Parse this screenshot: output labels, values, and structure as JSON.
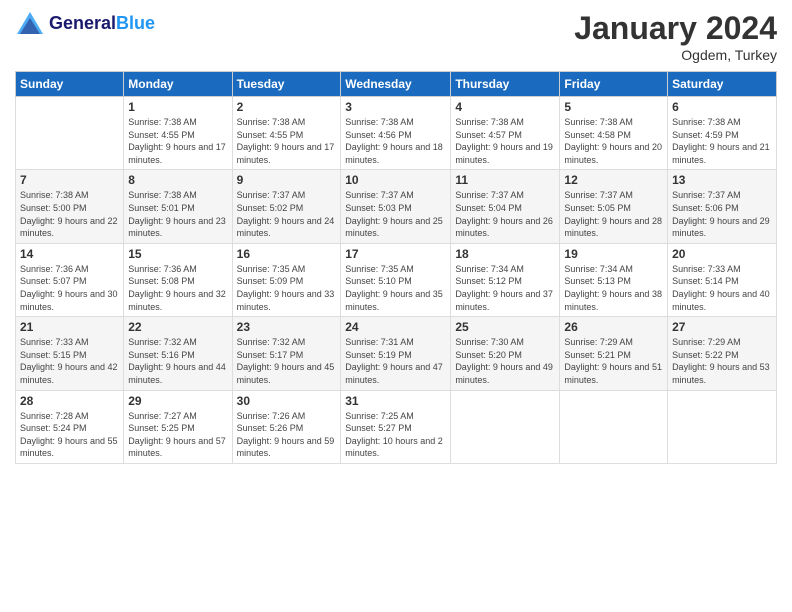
{
  "header": {
    "logo_line1": "General",
    "logo_line2": "Blue",
    "month_year": "January 2024",
    "location": "Ogdem, Turkey"
  },
  "days_of_week": [
    "Sunday",
    "Monday",
    "Tuesday",
    "Wednesday",
    "Thursday",
    "Friday",
    "Saturday"
  ],
  "weeks": [
    [
      {
        "day": "",
        "sunrise": "",
        "sunset": "",
        "daylight": ""
      },
      {
        "day": "1",
        "sunrise": "Sunrise: 7:38 AM",
        "sunset": "Sunset: 4:55 PM",
        "daylight": "Daylight: 9 hours and 17 minutes."
      },
      {
        "day": "2",
        "sunrise": "Sunrise: 7:38 AM",
        "sunset": "Sunset: 4:55 PM",
        "daylight": "Daylight: 9 hours and 17 minutes."
      },
      {
        "day": "3",
        "sunrise": "Sunrise: 7:38 AM",
        "sunset": "Sunset: 4:56 PM",
        "daylight": "Daylight: 9 hours and 18 minutes."
      },
      {
        "day": "4",
        "sunrise": "Sunrise: 7:38 AM",
        "sunset": "Sunset: 4:57 PM",
        "daylight": "Daylight: 9 hours and 19 minutes."
      },
      {
        "day": "5",
        "sunrise": "Sunrise: 7:38 AM",
        "sunset": "Sunset: 4:58 PM",
        "daylight": "Daylight: 9 hours and 20 minutes."
      },
      {
        "day": "6",
        "sunrise": "Sunrise: 7:38 AM",
        "sunset": "Sunset: 4:59 PM",
        "daylight": "Daylight: 9 hours and 21 minutes."
      }
    ],
    [
      {
        "day": "7",
        "sunrise": "Sunrise: 7:38 AM",
        "sunset": "Sunset: 5:00 PM",
        "daylight": "Daylight: 9 hours and 22 minutes."
      },
      {
        "day": "8",
        "sunrise": "Sunrise: 7:38 AM",
        "sunset": "Sunset: 5:01 PM",
        "daylight": "Daylight: 9 hours and 23 minutes."
      },
      {
        "day": "9",
        "sunrise": "Sunrise: 7:37 AM",
        "sunset": "Sunset: 5:02 PM",
        "daylight": "Daylight: 9 hours and 24 minutes."
      },
      {
        "day": "10",
        "sunrise": "Sunrise: 7:37 AM",
        "sunset": "Sunset: 5:03 PM",
        "daylight": "Daylight: 9 hours and 25 minutes."
      },
      {
        "day": "11",
        "sunrise": "Sunrise: 7:37 AM",
        "sunset": "Sunset: 5:04 PM",
        "daylight": "Daylight: 9 hours and 26 minutes."
      },
      {
        "day": "12",
        "sunrise": "Sunrise: 7:37 AM",
        "sunset": "Sunset: 5:05 PM",
        "daylight": "Daylight: 9 hours and 28 minutes."
      },
      {
        "day": "13",
        "sunrise": "Sunrise: 7:37 AM",
        "sunset": "Sunset: 5:06 PM",
        "daylight": "Daylight: 9 hours and 29 minutes."
      }
    ],
    [
      {
        "day": "14",
        "sunrise": "Sunrise: 7:36 AM",
        "sunset": "Sunset: 5:07 PM",
        "daylight": "Daylight: 9 hours and 30 minutes."
      },
      {
        "day": "15",
        "sunrise": "Sunrise: 7:36 AM",
        "sunset": "Sunset: 5:08 PM",
        "daylight": "Daylight: 9 hours and 32 minutes."
      },
      {
        "day": "16",
        "sunrise": "Sunrise: 7:35 AM",
        "sunset": "Sunset: 5:09 PM",
        "daylight": "Daylight: 9 hours and 33 minutes."
      },
      {
        "day": "17",
        "sunrise": "Sunrise: 7:35 AM",
        "sunset": "Sunset: 5:10 PM",
        "daylight": "Daylight: 9 hours and 35 minutes."
      },
      {
        "day": "18",
        "sunrise": "Sunrise: 7:34 AM",
        "sunset": "Sunset: 5:12 PM",
        "daylight": "Daylight: 9 hours and 37 minutes."
      },
      {
        "day": "19",
        "sunrise": "Sunrise: 7:34 AM",
        "sunset": "Sunset: 5:13 PM",
        "daylight": "Daylight: 9 hours and 38 minutes."
      },
      {
        "day": "20",
        "sunrise": "Sunrise: 7:33 AM",
        "sunset": "Sunset: 5:14 PM",
        "daylight": "Daylight: 9 hours and 40 minutes."
      }
    ],
    [
      {
        "day": "21",
        "sunrise": "Sunrise: 7:33 AM",
        "sunset": "Sunset: 5:15 PM",
        "daylight": "Daylight: 9 hours and 42 minutes."
      },
      {
        "day": "22",
        "sunrise": "Sunrise: 7:32 AM",
        "sunset": "Sunset: 5:16 PM",
        "daylight": "Daylight: 9 hours and 44 minutes."
      },
      {
        "day": "23",
        "sunrise": "Sunrise: 7:32 AM",
        "sunset": "Sunset: 5:17 PM",
        "daylight": "Daylight: 9 hours and 45 minutes."
      },
      {
        "day": "24",
        "sunrise": "Sunrise: 7:31 AM",
        "sunset": "Sunset: 5:19 PM",
        "daylight": "Daylight: 9 hours and 47 minutes."
      },
      {
        "day": "25",
        "sunrise": "Sunrise: 7:30 AM",
        "sunset": "Sunset: 5:20 PM",
        "daylight": "Daylight: 9 hours and 49 minutes."
      },
      {
        "day": "26",
        "sunrise": "Sunrise: 7:29 AM",
        "sunset": "Sunset: 5:21 PM",
        "daylight": "Daylight: 9 hours and 51 minutes."
      },
      {
        "day": "27",
        "sunrise": "Sunrise: 7:29 AM",
        "sunset": "Sunset: 5:22 PM",
        "daylight": "Daylight: 9 hours and 53 minutes."
      }
    ],
    [
      {
        "day": "28",
        "sunrise": "Sunrise: 7:28 AM",
        "sunset": "Sunset: 5:24 PM",
        "daylight": "Daylight: 9 hours and 55 minutes."
      },
      {
        "day": "29",
        "sunrise": "Sunrise: 7:27 AM",
        "sunset": "Sunset: 5:25 PM",
        "daylight": "Daylight: 9 hours and 57 minutes."
      },
      {
        "day": "30",
        "sunrise": "Sunrise: 7:26 AM",
        "sunset": "Sunset: 5:26 PM",
        "daylight": "Daylight: 9 hours and 59 minutes."
      },
      {
        "day": "31",
        "sunrise": "Sunrise: 7:25 AM",
        "sunset": "Sunset: 5:27 PM",
        "daylight": "Daylight: 10 hours and 2 minutes."
      },
      {
        "day": "",
        "sunrise": "",
        "sunset": "",
        "daylight": ""
      },
      {
        "day": "",
        "sunrise": "",
        "sunset": "",
        "daylight": ""
      },
      {
        "day": "",
        "sunrise": "",
        "sunset": "",
        "daylight": ""
      }
    ]
  ]
}
